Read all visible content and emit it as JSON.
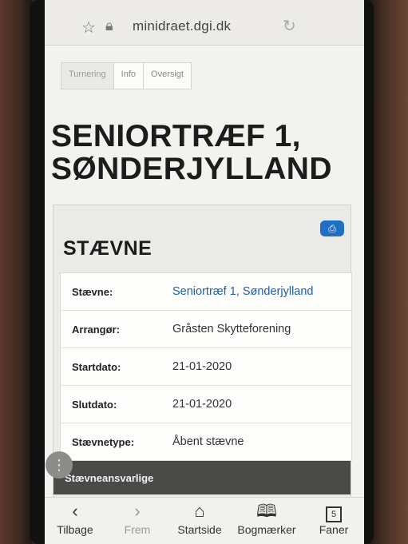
{
  "browser": {
    "url": "minidraet.dgi.dk"
  },
  "tabs": [
    {
      "label": "Turnering"
    },
    {
      "label": "Info"
    },
    {
      "label": "Oversigt"
    }
  ],
  "page": {
    "title_line1": "SENIORTRÆF 1,",
    "title_line2": "SØNDERJYLLAND"
  },
  "card": {
    "title": "STÆVNE",
    "rows": [
      {
        "label": "Stævne:",
        "value": "Seniortræf 1, Sønderjylland"
      },
      {
        "label": "Arrangør:",
        "value": "Gråsten Skytteforening"
      },
      {
        "label": "Startdato:",
        "value": "21-01-2020"
      },
      {
        "label": "Slutdato:",
        "value": "21-01-2020"
      },
      {
        "label": "Stævnetype:",
        "value": "Åbent stævne"
      }
    ],
    "section_header": "Stævneansvarlige"
  },
  "toolbar": {
    "back": "Tilbage",
    "forward": "Frem",
    "home": "Startside",
    "bookmarks": "Bogmærker",
    "tabs": "Faner",
    "tab_count": "5"
  },
  "colors": {
    "accent": "#1f6fc4",
    "link": "#1f5fa8"
  }
}
